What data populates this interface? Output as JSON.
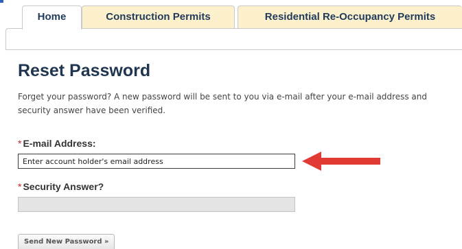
{
  "tabs": [
    {
      "label": "Home",
      "active": true
    },
    {
      "label": "Construction Permits",
      "active": false
    },
    {
      "label": "Residential Re-Occupancy Permits",
      "active": false
    }
  ],
  "colors": {
    "tab_inactive_bg": "#fdf0cc",
    "heading": "#1f3550",
    "required_marker": "#cc1f1f",
    "arrow": "#e23a34"
  },
  "form": {
    "title": "Reset Password",
    "description": "Forget your password? A new password will be sent to you via e-mail after your e-mail address and security answer have been verified.",
    "required_marker": "*",
    "email": {
      "label": "E-mail Address:",
      "placeholder": "Enter account holder's email address",
      "value": ""
    },
    "security": {
      "label": "Security Answer?",
      "value": ""
    },
    "submit_label": "Send New Password »"
  },
  "annotation": {
    "icon": "left-arrow-icon"
  }
}
